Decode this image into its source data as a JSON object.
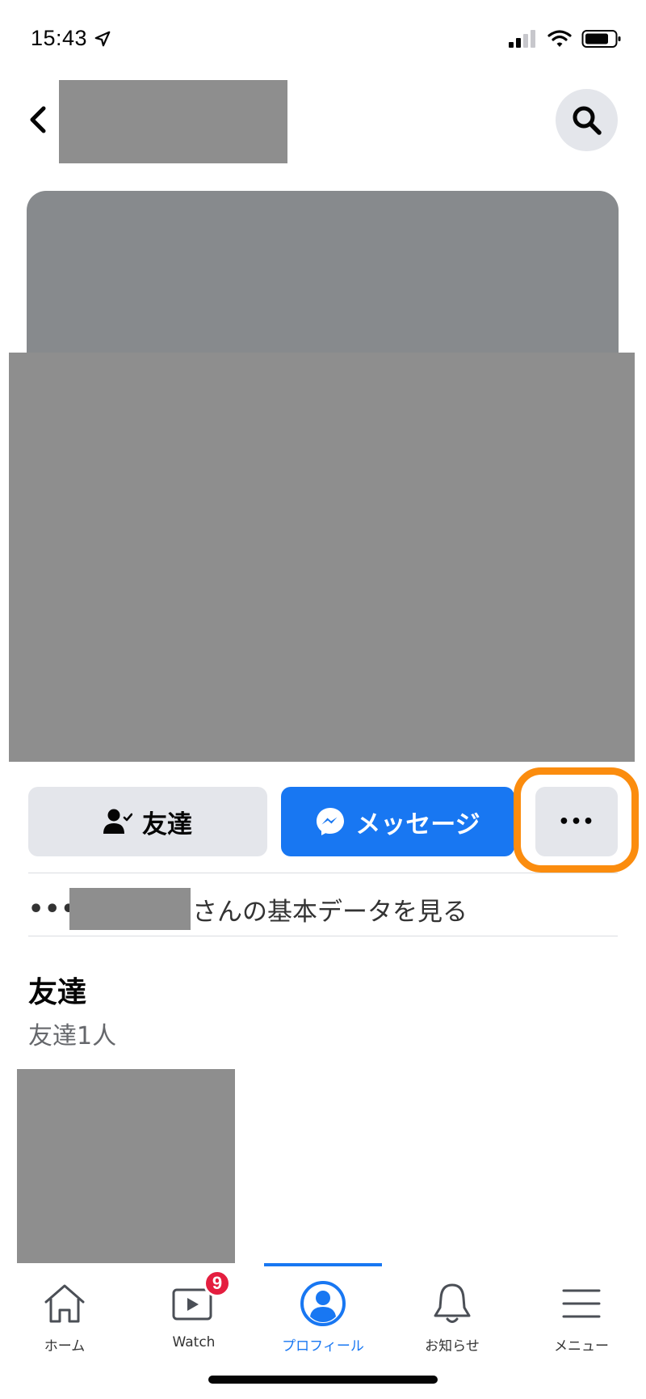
{
  "status_bar": {
    "time": "15:43"
  },
  "actions": {
    "friends_label": "友達",
    "message_label": "メッセージ",
    "more_label": "•••"
  },
  "basic_info": {
    "dots": "•••",
    "suffix": "さんの基本データを見る"
  },
  "friends_section": {
    "title": "友達",
    "count_text": "友達1人"
  },
  "tabs": [
    {
      "label": "ホーム",
      "icon": "home-icon"
    },
    {
      "label": "Watch",
      "icon": "watch-icon",
      "badge": "9"
    },
    {
      "label": "プロフィール",
      "icon": "profile-icon",
      "active": true
    },
    {
      "label": "お知らせ",
      "icon": "bell-icon"
    },
    {
      "label": "メニュー",
      "icon": "menu-icon"
    }
  ],
  "colors": {
    "accent": "#1877f2",
    "highlight": "#fb8c0e",
    "badge": "#e41e3f"
  }
}
